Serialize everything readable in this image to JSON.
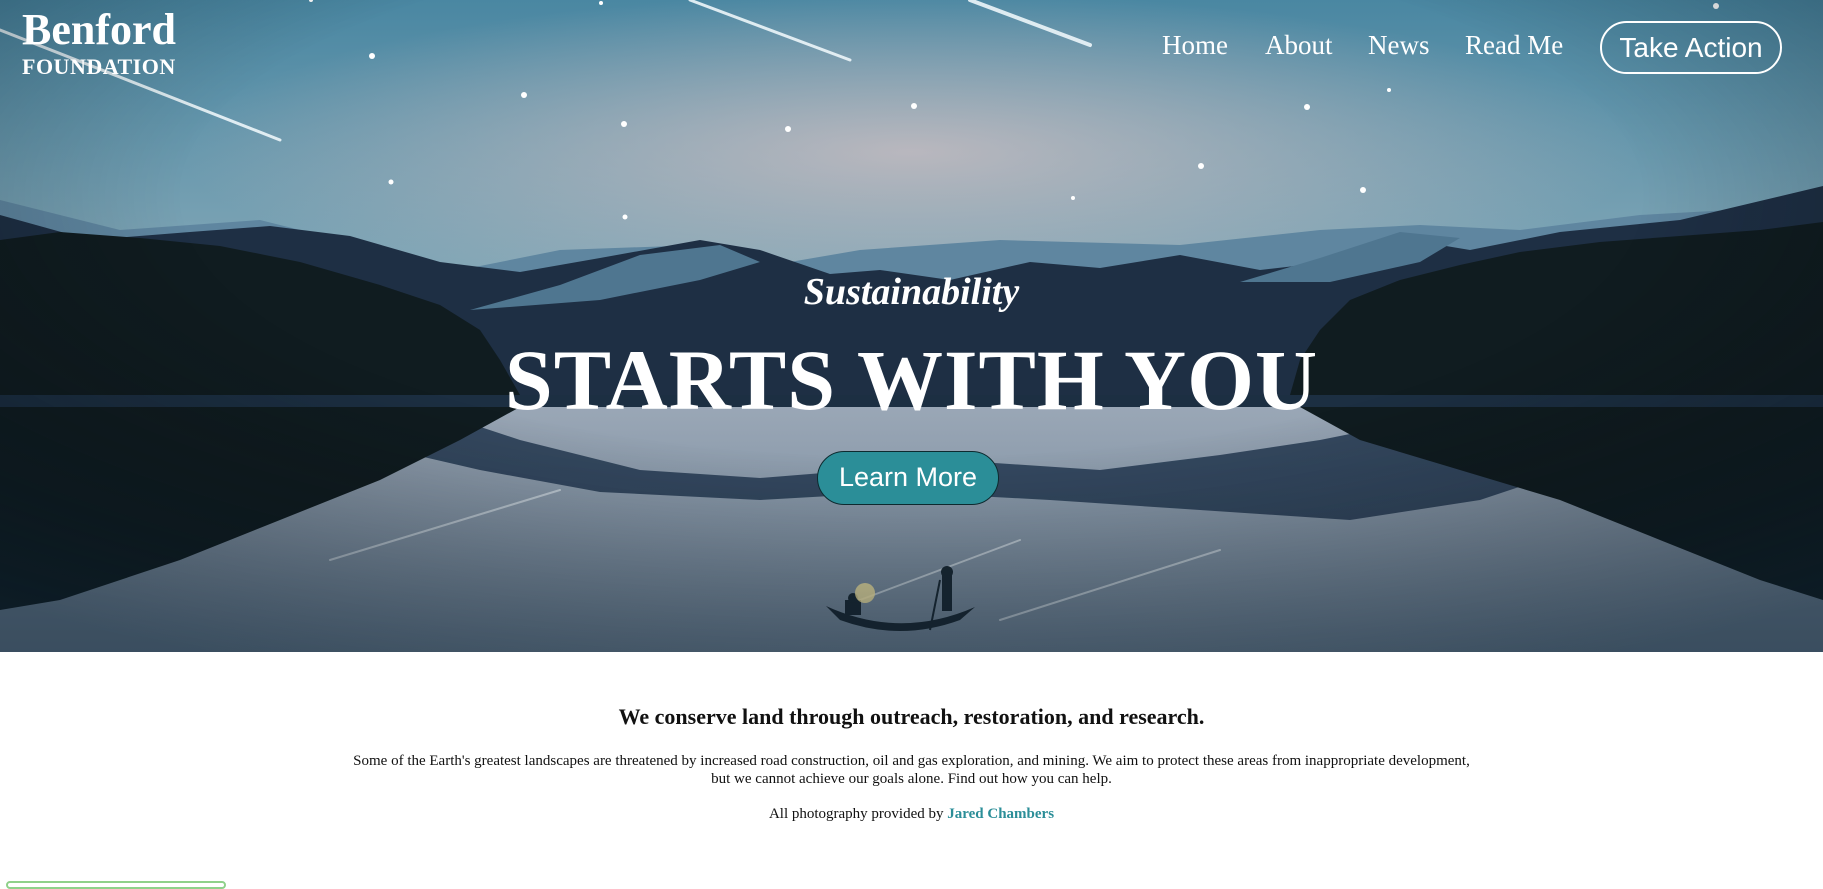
{
  "brand": {
    "name_line1": "Benford",
    "name_line2": "FOUNDATION"
  },
  "nav": {
    "items": [
      "Home",
      "About",
      "News",
      "Read Me"
    ],
    "cta_label": "Take Action"
  },
  "hero": {
    "tagline": "Sustainability",
    "headline": "STARTS WITH YOU",
    "button_label": "Learn More"
  },
  "intro": {
    "heading": "We conserve land through outreach, restoration, and research.",
    "body": "Some of the Earth's greatest landscapes are threatened by increased road construction, oil and gas exploration, and mining. We aim to protect these areas from inappropriate development, but we cannot achieve our goals alone. Find out how you can help.",
    "credit_prefix": "All photography provided by ",
    "credit_name": "Jared Chambers"
  },
  "colors": {
    "accent": "#2b8e98",
    "sky_top": "#4f86a0",
    "forest": "#0f1b1e"
  }
}
